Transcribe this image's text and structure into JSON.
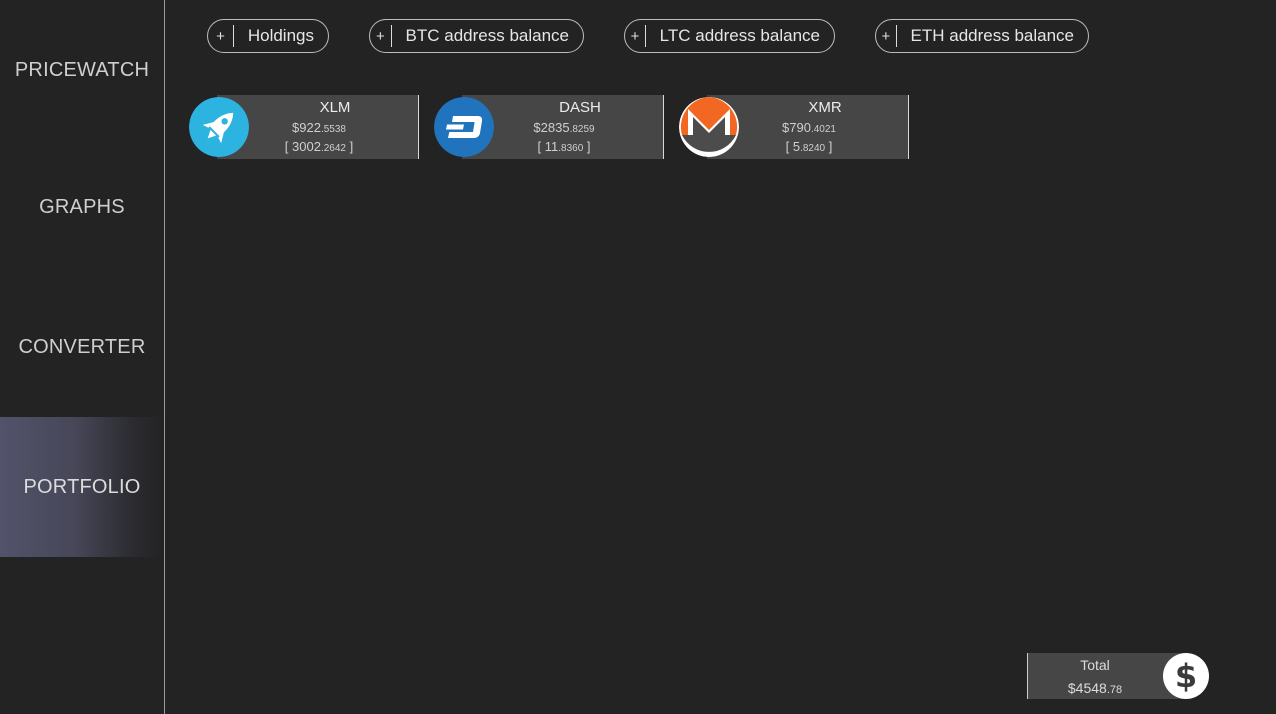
{
  "nav": {
    "pricewatch": "PRICEWATCH",
    "graphs": "GRAPHS",
    "converter": "CONVERTER",
    "portfolio": "PORTFOLIO"
  },
  "actions": [
    {
      "plus": "+",
      "label": "Holdings"
    },
    {
      "plus": "+",
      "label": "BTC address balance"
    },
    {
      "plus": "+",
      "label": "LTC address balance"
    },
    {
      "plus": "+",
      "label": "ETH address balance"
    }
  ],
  "coins": [
    {
      "symbol": "XLM",
      "value_main": "$922",
      "value_dec": ".5538",
      "hold_main": "3002",
      "hold_dec": ".2642",
      "icon": "rocket-icon",
      "color": "#2db3e0"
    },
    {
      "symbol": "DASH",
      "value_main": "$2835",
      "value_dec": ".8259",
      "hold_main": "11",
      "hold_dec": ".8360",
      "icon": "dash-icon",
      "color": "#1f74bd"
    },
    {
      "symbol": "XMR",
      "value_main": "$790",
      "value_dec": ".4021",
      "hold_main": "5",
      "hold_dec": ".8240",
      "icon": "monero-icon",
      "color": "#f26822"
    }
  ],
  "bracket_open": "[ ",
  "bracket_close": " ]",
  "total": {
    "label": "Total",
    "value_main": "$4548",
    "value_dec": ".78",
    "icon_glyph": "$"
  }
}
